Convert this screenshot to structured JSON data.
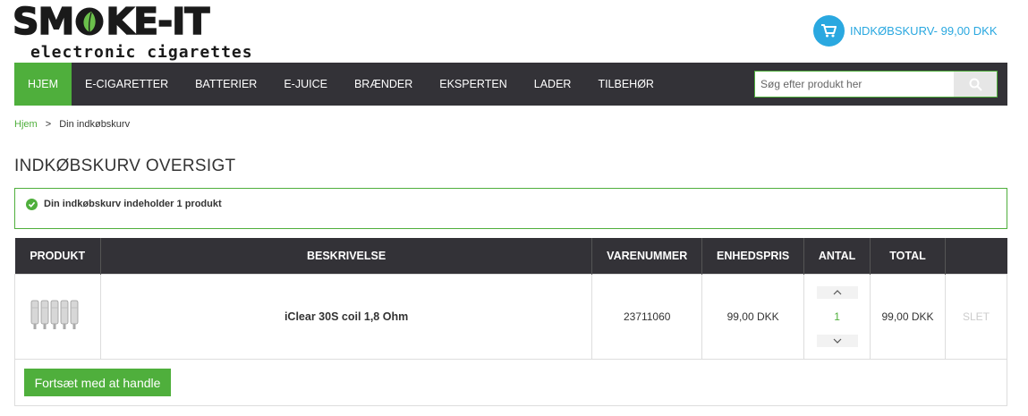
{
  "logo": {
    "main_left": "SM",
    "main_right": "KE-IT",
    "tagline": "electronic cigarettes"
  },
  "cart": {
    "label": "INDKØBSKURV- 99,00 DKK",
    "icon": "shopping-cart-icon",
    "color": "#2aa8e0"
  },
  "nav": {
    "items": [
      "HJEM",
      "E-CIGARETTER",
      "BATTERIER",
      "E-JUICE",
      "BRÆNDER",
      "EKSPERTEN",
      "LADER",
      "TILBEHØR"
    ],
    "active_index": 0,
    "active_color": "#4faf3c",
    "bg_color": "#333237"
  },
  "search": {
    "placeholder": "Søg efter produkt her",
    "icon": "search-icon"
  },
  "breadcrumb": {
    "home": "Hjem",
    "separator": ">",
    "current": "Din indkøbskurv"
  },
  "page": {
    "title": "INDKØBSKURV OVERSIGT"
  },
  "notice": {
    "text": "Din indkøbskurv indeholder 1 produkt",
    "icon": "check-circle-icon"
  },
  "table": {
    "headers": [
      "PRODUKT",
      "BESKRIVELSE",
      "VARENUMMER",
      "ENHEDSPRIS",
      "ANTAL",
      "TOTAL",
      ""
    ],
    "rows": [
      {
        "image": "coil-pack-image",
        "description": "iClear 30S coil 1,8 Ohm",
        "sku": "23711060",
        "unit_price": "99,00 DKK",
        "quantity": "1",
        "total": "99,00 DKK",
        "delete": "SLET"
      }
    ]
  },
  "actions": {
    "continue_label": "Fortsæt med at handle"
  }
}
